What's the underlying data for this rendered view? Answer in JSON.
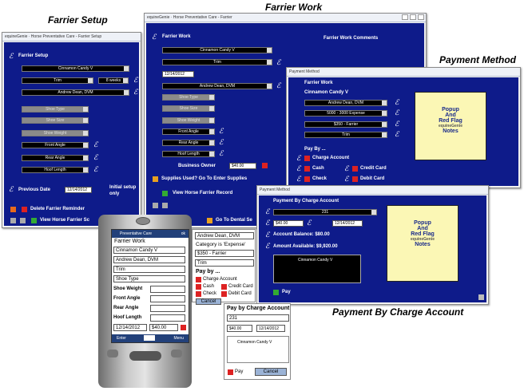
{
  "captions": {
    "farrier_setup": "Farrier Setup",
    "farrier_work": "Farrier Work",
    "payment_method": "Payment Method",
    "payment_by_charge": "Payment By Charge Account"
  },
  "setup": {
    "title_bar": "equineGenie · Horse Preventative Care - Farrier Setup",
    "header": "Farrier Setup",
    "horse": "Cinnamon Candy V",
    "service": "Trim",
    "interval": "8 weeks",
    "farrier": "Andrew Dean, DVM",
    "shoe_type": "Shoe Type",
    "shoe_size": "Shoe Size",
    "shoe_weight": "Shoe Weight",
    "front_angle": "Front Angle",
    "rear_angle": "Rear Angle",
    "hoof_length": "Hoof Length",
    "previous_date_label": "Previous Date",
    "previous_date": "12/14/2012",
    "initial_setup": "Initial setup only",
    "delete_reminder": "Delete Farrier Reminder",
    "view_record": "View Horse Farrier Sc"
  },
  "work": {
    "title_bar": "equineGenie · Horse Preventative Care - Farrier",
    "header": "Farrier Work",
    "comments_header": "Farrier Work Comments",
    "horse": "Cinnamon Candy V",
    "service": "Trim",
    "date": "12/14/2012",
    "farrier": "Andrew Dean, DVM",
    "shoe_type": "Shoe Type",
    "shoe_size": "Shoe Size",
    "shoe_weight": "Shoe Weight",
    "front_angle": "Front Angle",
    "rear_angle": "Rear Angle",
    "hoof_length": "Hoof Length",
    "owner_label": "Business Owner",
    "owner_amount": "$40.00",
    "supplies": "Supplies Used? Go To Enter Supplies",
    "view_record": "View Horse Farrier Record",
    "dental": "Go To Dental Se"
  },
  "payment": {
    "title_bar": "Payment Method",
    "header": "Farrier Work",
    "horse": "Cinnamon Candy V",
    "farrier": "Andrew Dean, DVM",
    "expense": "5000 - 3000 Expense",
    "fee": "$350 - Farrier",
    "service": "Trim",
    "pay_by": "Pay By ...",
    "charge_account": "Charge Account",
    "cash": "Cash",
    "check": "Check",
    "credit_card": "Credit Card",
    "debit_card": "Debit Card",
    "note_lines": [
      "Popup",
      "And",
      "Red Flag",
      "equineGenie",
      "Notes"
    ]
  },
  "charge": {
    "title_bar": "Payment Method",
    "header": "Payment By Charge Account",
    "account": "231",
    "amount": "$40.00",
    "date": "12/14/2012",
    "balance": "Account Balance:  $80.00",
    "available": "Amount Available: $9,920.00",
    "memo": "Cinnamon Candy V",
    "pay": "Pay",
    "note_lines": [
      "Popup",
      "And",
      "Red Flag",
      "equineGenie",
      "Notes"
    ]
  },
  "phone": {
    "header": "Preventative Care",
    "ok": "ok",
    "title": "Farrier Work",
    "horse": "Cinnamon Candy V",
    "farrier": "Andrew Dean, DVM",
    "service": "Trim",
    "shoe_type": "Shoe Type",
    "shoe_weight": "Shoe Weight",
    "front_angle": "Front Angle",
    "rear_angle": "Rear Angle",
    "hoof_length": "Hoof Length",
    "date": "12/14/2012",
    "amount": "$40.00",
    "enter": "Enter",
    "menu": "Menu"
  },
  "mobile_pay": {
    "farrier": "Andrew Dean, DVM",
    "category": "Category is 'Expense'",
    "fee": "$350 - Farrier",
    "service": "Trim",
    "pay_by": "Pay by ...",
    "charge_account": "Charge Account",
    "cash": "Cash",
    "credit_card": "Credit Card",
    "check": "Check",
    "debit_card": "Debit Card",
    "cancel": "Cancel"
  },
  "mobile_charge": {
    "header": "Pay by Charge Account",
    "account": "231",
    "amount": "$40.00",
    "date": "12/14/2012",
    "memo": "Cinnamon Candy V",
    "pay": "Pay",
    "cancel": "Cancel"
  }
}
